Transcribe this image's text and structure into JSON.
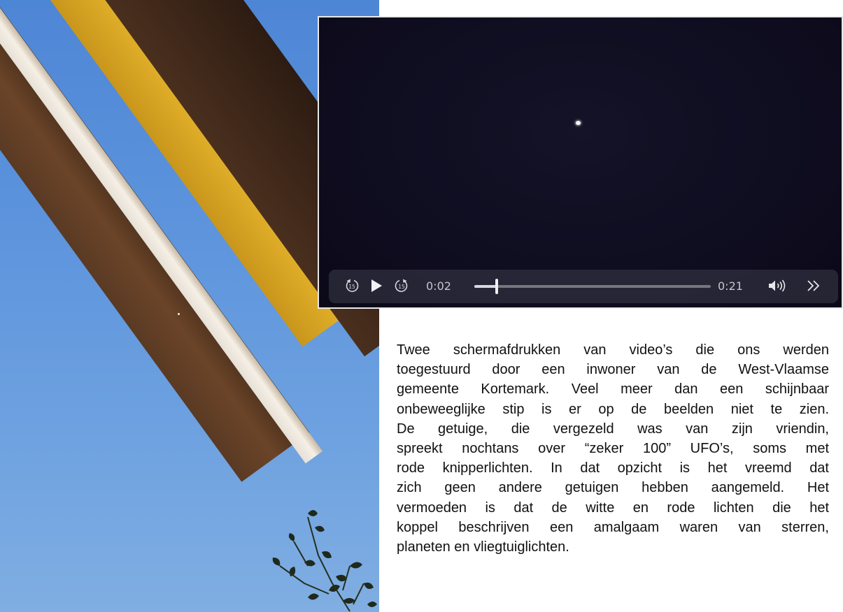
{
  "video_player": {
    "rewind_label": "15",
    "forward_label": "15",
    "current_time": "0:02",
    "duration": "0:21",
    "progress_fraction": 0.095,
    "icons": {
      "rewind": "rewind-15-icon",
      "play": "play-icon",
      "forward": "forward-15-icon",
      "volume": "volume-icon",
      "more": "chevron-double-right-icon"
    }
  },
  "caption": {
    "lines": [
      "Twee schermafdrukken van video’s die ons werden",
      "toegestuurd door een inwoner van de West-Vlaamse",
      "gemeente Kortemark. Veel meer dan een schijnbaar",
      "onbeweeglijke stip is er op de beelden niet te zien.",
      "De getuige, die vergezeld was van zijn vriendin,",
      "spreekt nochtans over “zeker 100” UFO’s, soms met",
      "rode knipperlichten. In dat opzicht is het vreemd dat",
      "zich geen andere getuigen hebben aangemeld. Het",
      "vermoeden is dat de witte en rode lichten die het",
      "koppel beschrijven een amalgaam waren van sterren,",
      "planeten en vliegtuiglichten."
    ]
  },
  "colors": {
    "sky": "#5c93dc",
    "night_sky": "#0f0d20",
    "roof_yellow": "#e4b32b",
    "caption_text": "#111111"
  }
}
